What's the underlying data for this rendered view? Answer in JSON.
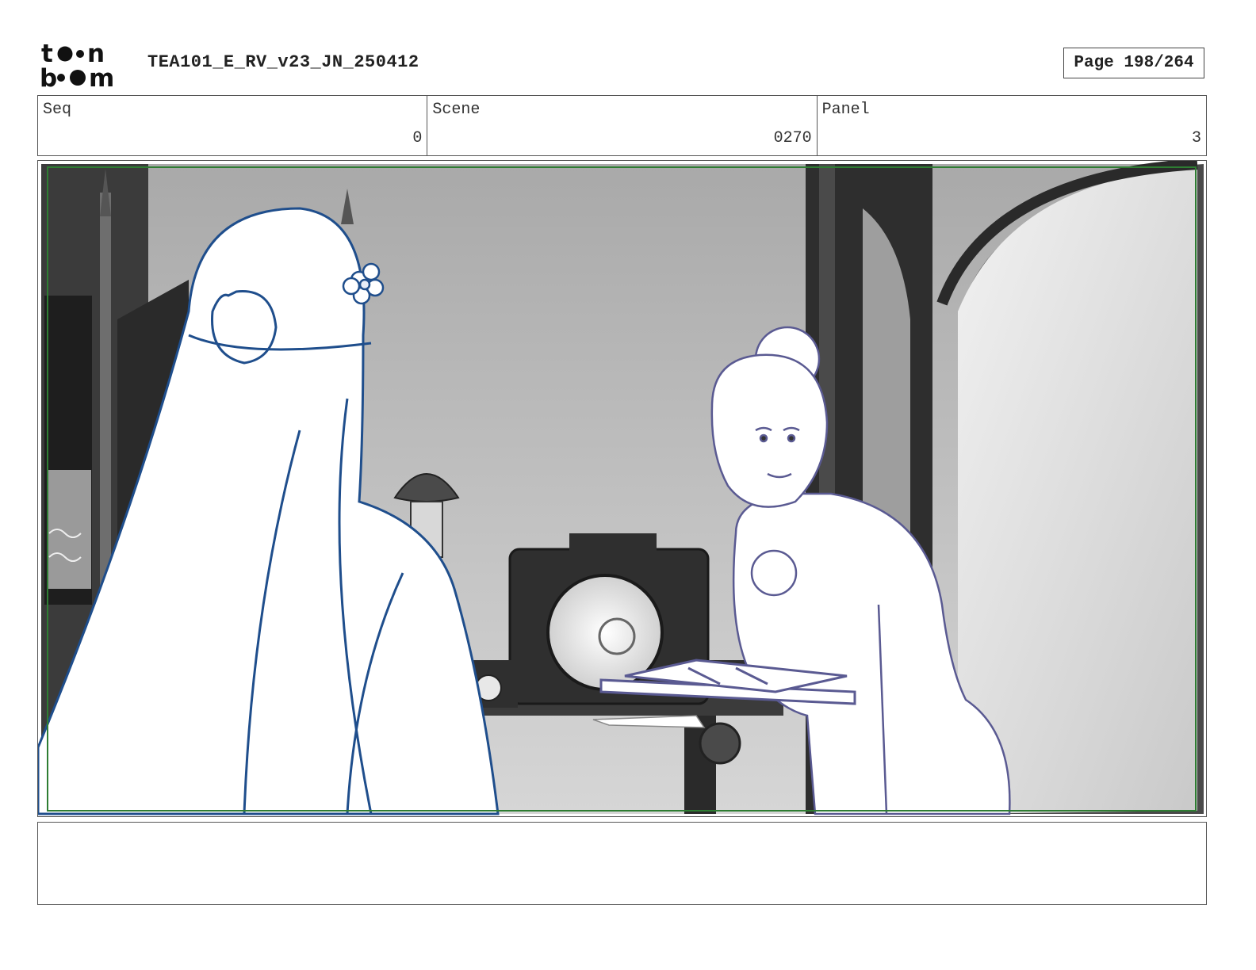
{
  "header": {
    "logo_text_top": "toon",
    "logo_text_bottom": "boom",
    "doc_title": "TEA101_E_RV_v23_JN_250412",
    "page_label": "Page 198/264"
  },
  "info": {
    "seq_label": "Seq",
    "seq_value": "0",
    "scene_label": "Scene",
    "scene_value": "0270",
    "panel_label": "Panel",
    "panel_value": "3"
  },
  "panel": {
    "image_description_icon": "storyboard-drawing",
    "safe_frame_color": "#2e7d32",
    "line_color_left_figure": "#1f4e8c",
    "line_color_right_figure": "#5a5a92"
  },
  "notes": {
    "text": ""
  }
}
